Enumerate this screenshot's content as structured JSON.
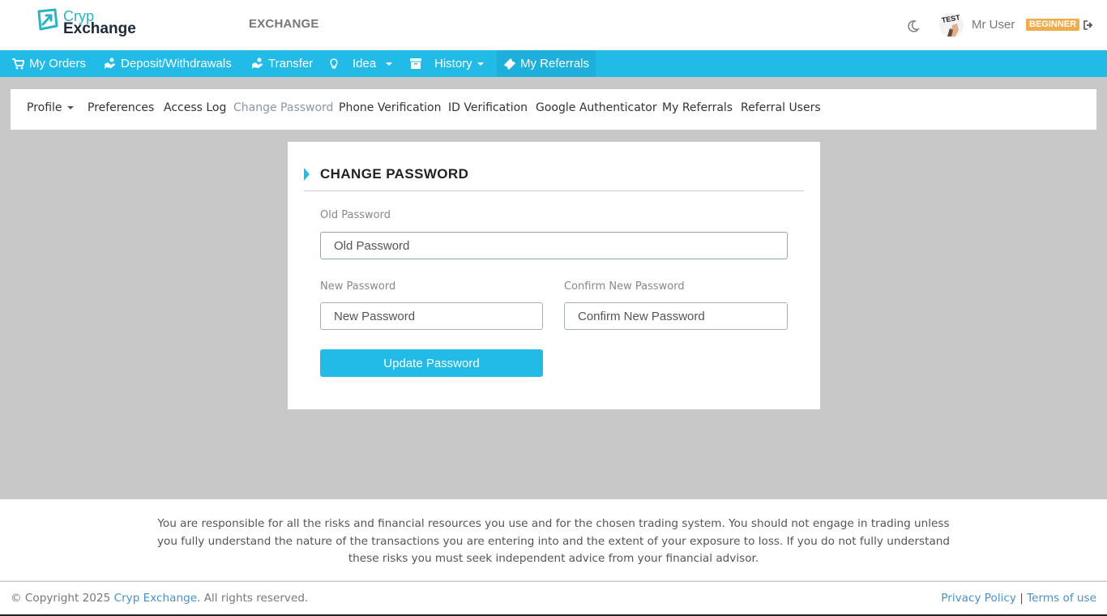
{
  "brand": {
    "line1": "Cryp",
    "line2": "Exchange",
    "color": "#2bb5c4"
  },
  "header": {
    "exchange_label": "EXCHANGE",
    "theme_icon": "moon-icon",
    "user_name": "Mr User",
    "level_badge": "BEGINNER",
    "logout_icon": "logout-icon"
  },
  "nav": {
    "accent": "#22bbe8",
    "items": [
      {
        "label": "My Orders",
        "icon": "cart-icon"
      },
      {
        "label": "Deposit/Withdrawals",
        "icon": "hand-coin-icon"
      },
      {
        "label": "Transfer",
        "icon": "hand-coin-icon"
      },
      {
        "label": "Idea",
        "icon": "lightbulb-icon",
        "dropdown": true
      },
      {
        "label": "History",
        "icon": "archive-icon",
        "dropdown": true
      },
      {
        "label": "My Referrals",
        "icon": "ticket-icon",
        "active": true
      }
    ]
  },
  "subnav": {
    "tabs": [
      {
        "label": "Profile",
        "dropdown": true
      },
      {
        "label": "Preferences"
      },
      {
        "label": "Access Log"
      },
      {
        "label": "Change Password",
        "current": true
      },
      {
        "label": "Phone Verification"
      },
      {
        "label": "ID Verification"
      },
      {
        "label": "Google Authenticator"
      },
      {
        "label": "My Referrals"
      },
      {
        "label": "Referral Users"
      }
    ]
  },
  "form": {
    "title": "CHANGE PASSWORD",
    "old_password": {
      "label": "Old Password",
      "placeholder": "Old Password"
    },
    "new_password": {
      "label": "New Password",
      "placeholder": "New Password"
    },
    "confirm_password": {
      "label": "Confirm New Password",
      "placeholder": "Confirm New Password"
    },
    "submit_label": "Update Password"
  },
  "footer": {
    "disclaimer": "You are responsible for all the risks and financial resources you use and for the chosen trading system. You should not engage in trading unless you fully understand the nature of the transactions you are entering into and the extent of your exposure to loss. If you do not fully understand these risks you must seek independent advice from your financial advisor.",
    "copyright_prefix": "© Copyright 2025 ",
    "copyright_link": "Cryp Exchange",
    "copyright_suffix": ". All rights reserved.",
    "privacy_label": "Privacy Policy",
    "separator": "|",
    "terms_label": "Terms of use"
  }
}
